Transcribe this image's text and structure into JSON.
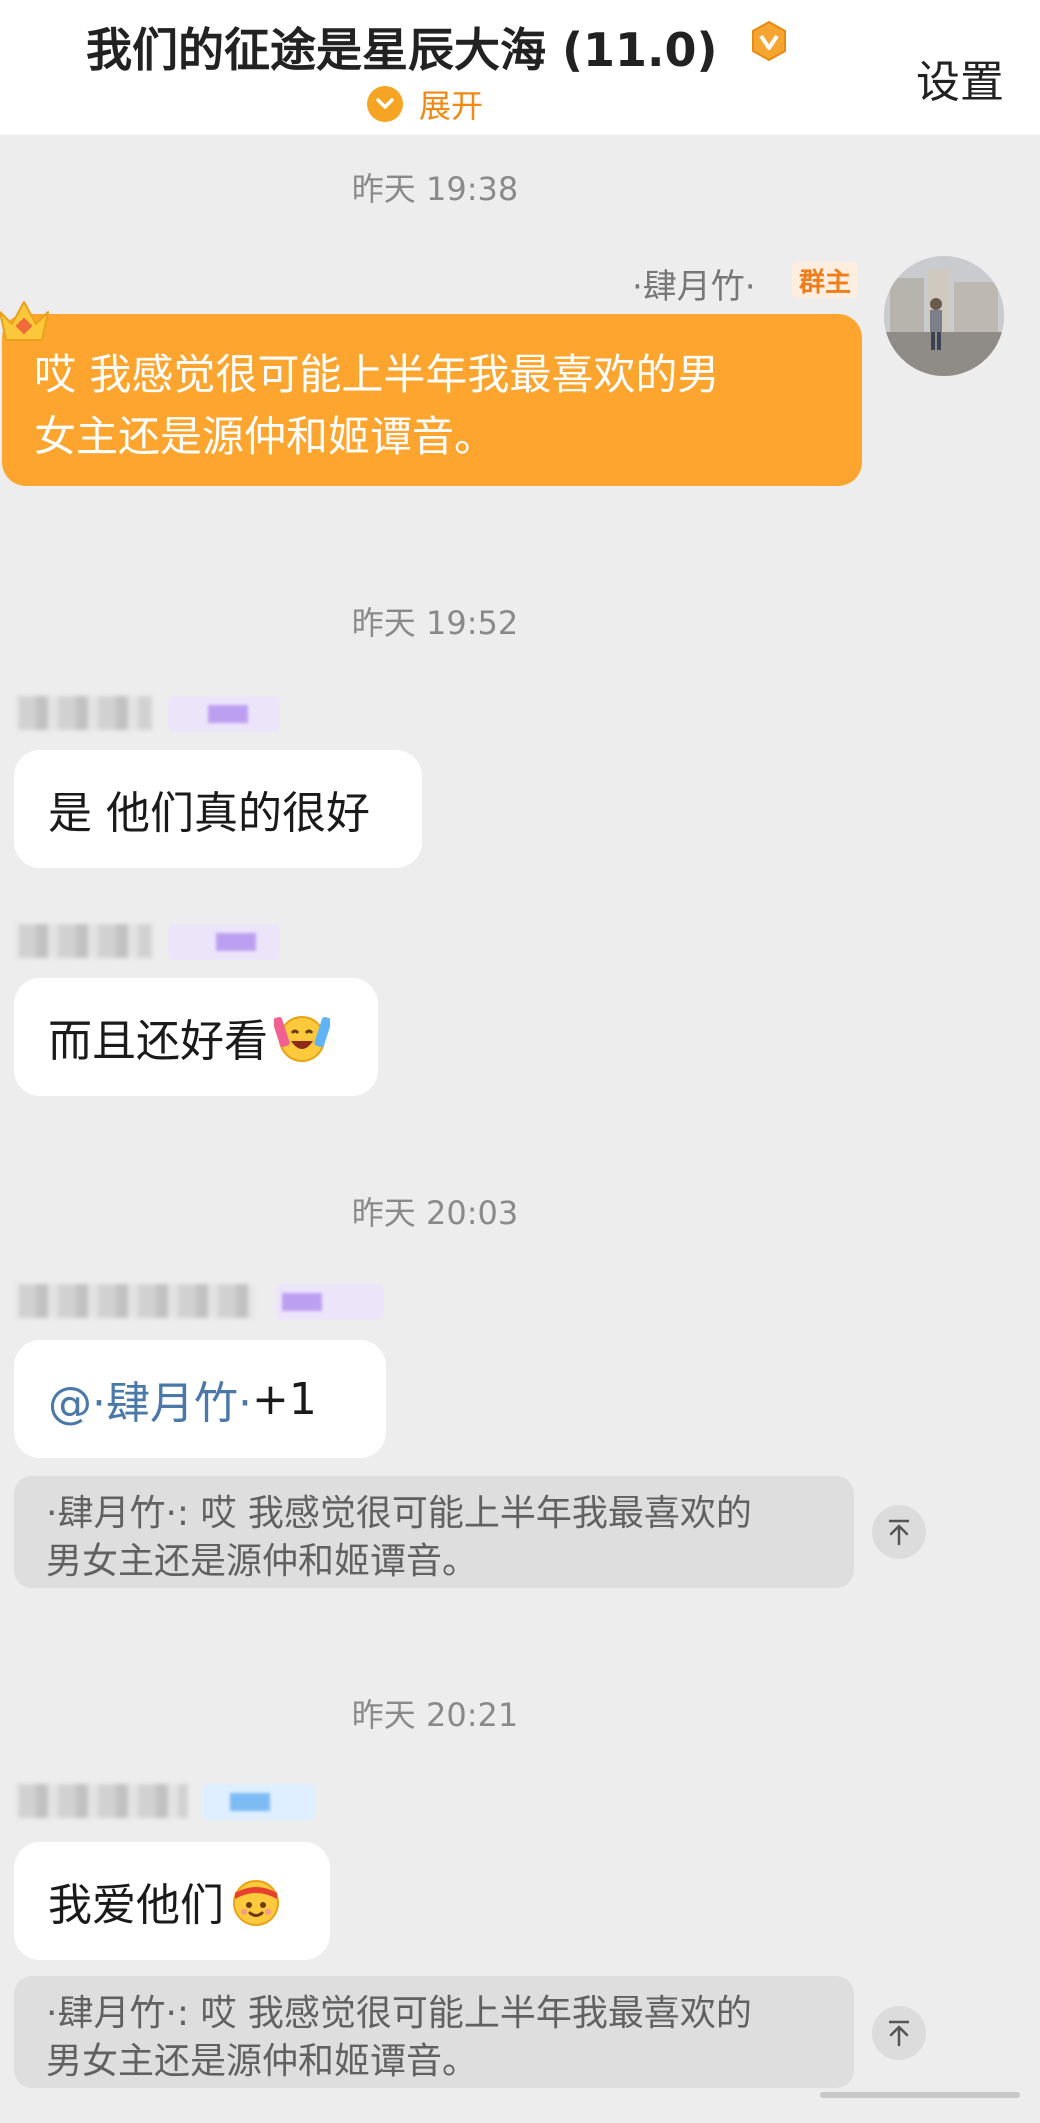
{
  "header": {
    "title": "我们的征途是星辰大海 (11.0)",
    "expand_label": "展开",
    "settings_label": "设置"
  },
  "colors": {
    "accent": "#fda52f",
    "owner_badge_text": "#f07d1a",
    "mention": "#4a78a8",
    "background": "#ededed"
  },
  "messages": [
    {
      "time": "昨天 19:38",
      "sender": "·肆月竹·",
      "badge": "群主",
      "text_line1": "哎 我感觉很可能上半年我最喜欢的男",
      "text_line2": "女主还是源仲和姬谭音。"
    },
    {
      "time": "昨天 19:52",
      "text": "是 他们真的很好"
    },
    {
      "text": "而且还好看",
      "emoji": "laughing-cheering-emoji"
    },
    {
      "time": "昨天 20:03",
      "mention": "@·肆月竹·",
      "text": " +1",
      "quote_line1": "·肆月竹·: 哎 我感觉很可能上半年我最喜欢的",
      "quote_line2": "男女主还是源仲和姬谭音。"
    },
    {
      "time": "昨天 20:21",
      "text": "我爱他们",
      "emoji": "headband-cheer-emoji",
      "quote_line1": "·肆月竹·: 哎 我感觉很可能上半年我最喜欢的",
      "quote_line2": "男女主还是源仲和姬谭音。"
    }
  ]
}
